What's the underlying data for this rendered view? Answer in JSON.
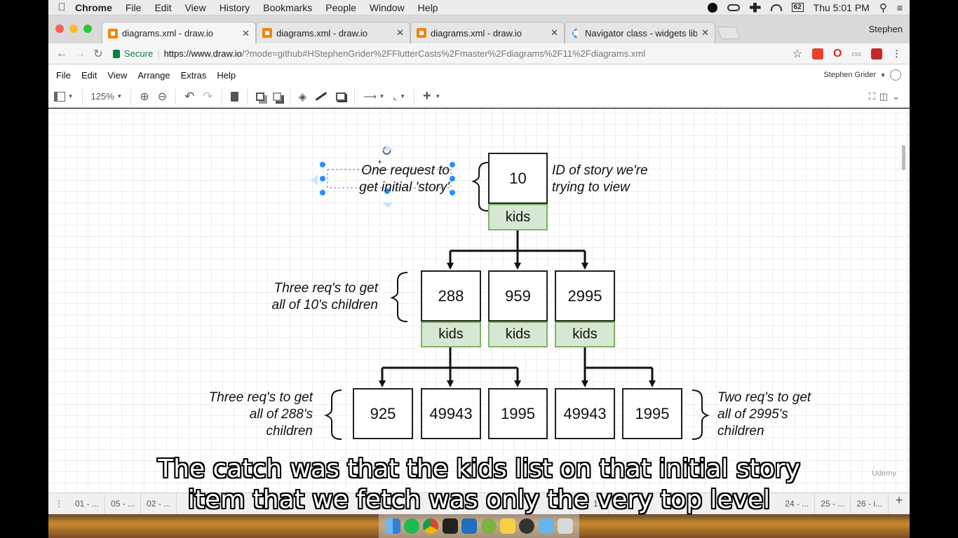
{
  "mac_menubar": {
    "app": "Chrome",
    "items": [
      "File",
      "Edit",
      "View",
      "History",
      "Bookmarks",
      "People",
      "Window",
      "Help"
    ],
    "clock": "Thu 5:01 PM",
    "battery": "62"
  },
  "browser": {
    "tabs": [
      {
        "title": "diagrams.xml - draw.io"
      },
      {
        "title": "diagrams.xml - draw.io"
      },
      {
        "title": "diagrams.xml - draw.io"
      },
      {
        "title": "Navigator class - widgets libra"
      }
    ],
    "profile": "Stephen",
    "secure_label": "Secure",
    "url_host": "https://www.draw.io",
    "url_path": "/?mode=github#HStephenGrider%2FFlutterCasts%2Fmaster%2Fdiagrams%2F11%2Fdiagrams.xml"
  },
  "drawio": {
    "menu": [
      "File",
      "Edit",
      "View",
      "Arrange",
      "Extras",
      "Help"
    ],
    "user": "Stephen Grider",
    "zoom": "125%"
  },
  "diagram": {
    "root": {
      "id": "10",
      "kids": "kids"
    },
    "level2": [
      {
        "id": "288",
        "kids": "kids"
      },
      {
        "id": "959",
        "kids": "kids"
      },
      {
        "id": "2995",
        "kids": "kids"
      }
    ],
    "level3": [
      "925",
      "49943",
      "1995",
      "49943",
      "1995"
    ],
    "notes": {
      "one_request_1": "One request to",
      "one_request_2": "get initial 'story'",
      "id_story_1": "ID of story we're",
      "id_story_2": "trying to view",
      "three_reqs_a1": "Three req's to get",
      "three_reqs_a2": "all of 10's children",
      "three_reqs_b1": "Three req's to get",
      "three_reqs_b2": "all of 288's",
      "three_reqs_b3": "children",
      "two_reqs_1": "Two req's to get",
      "two_reqs_2": "all of 2995's",
      "two_reqs_3": "children"
    }
  },
  "pages": {
    "left": [
      "01 - ...",
      "05 - ...",
      "02 - ..."
    ],
    "right": [
      "24 - ...",
      "25 - ...",
      "26 - i..."
    ],
    "partial": "17"
  },
  "subtitle": {
    "line1": "The catch was that the kids list on that initial story",
    "line2": "item that we fetch was only the very top level"
  },
  "watermark": "Udemy",
  "colors": {
    "kids_fill": "#d5e8d4",
    "kids_stroke": "#82b366",
    "selection": "#2a8cff",
    "drawio_orange": "#f08705"
  }
}
